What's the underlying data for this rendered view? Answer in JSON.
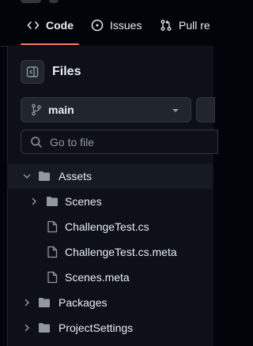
{
  "tabs": [
    {
      "label": "Code",
      "icon": "code-icon",
      "active": true
    },
    {
      "label": "Issues",
      "icon": "issue-opened-icon",
      "active": false
    },
    {
      "label": "Pull re",
      "icon": "git-pull-request-icon",
      "active": false
    }
  ],
  "files_panel": {
    "title": "Files",
    "toggle_icon": "sidebar-collapse-icon",
    "branch": {
      "name": "main",
      "icon": "git-branch-icon"
    },
    "search": {
      "placeholder": "Go to file",
      "icon": "search-icon"
    }
  },
  "tree": [
    {
      "name": "Assets",
      "type": "folder",
      "expanded": true,
      "selected": true,
      "depth": 0
    },
    {
      "name": "Scenes",
      "type": "folder",
      "expanded": false,
      "selected": false,
      "depth": 1
    },
    {
      "name": "ChallengeTest.cs",
      "type": "file",
      "selected": false,
      "depth": 1
    },
    {
      "name": "ChallengeTest.cs.meta",
      "type": "file",
      "selected": false,
      "depth": 1
    },
    {
      "name": "Scenes.meta",
      "type": "file",
      "selected": false,
      "depth": 1
    },
    {
      "name": "Packages",
      "type": "folder",
      "expanded": false,
      "selected": false,
      "depth": 0
    },
    {
      "name": "ProjectSettings",
      "type": "folder",
      "expanded": false,
      "selected": false,
      "depth": 0
    }
  ],
  "colors": {
    "background": "#010409",
    "panel": "#0d1117",
    "text": "#e6edf3",
    "muted": "#9198a1",
    "accent_underline": "#f78166",
    "selection_bar": "#4493f8"
  }
}
